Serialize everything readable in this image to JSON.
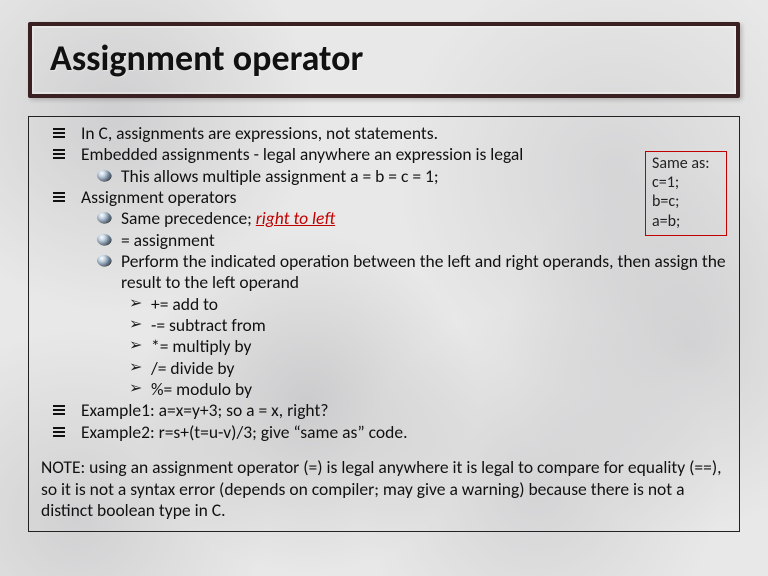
{
  "title": "Assignment operator",
  "bullets": {
    "b1": "In C, assignments are expressions, not statements.",
    "b2": "Embedded assignments - legal anywhere an expression is legal",
    "b2_1": "This allows multiple assignment a = b = c = 1;",
    "b3": "Assignment operators",
    "b3_1a": "Same precedence; ",
    "b3_1b": "right to left",
    "b3_2": "= assignment",
    "b3_3": "Perform the indicated operation between the left and right operands, then assign the result to the left operand",
    "b3_3_1": "+= add to",
    "b3_3_2": "-= subtract from",
    "b3_3_3": "*= multiply by",
    "b3_3_4": "/= divide by",
    "b3_3_5": "%= modulo by",
    "b4": "Example1: a=x=y+3; so a = x, right?",
    "b5": "Example2: r=s+(t=u-v)/3; give “same as” code."
  },
  "note": "NOTE: using an assignment operator (=) is legal anywhere it is legal to compare for equality (==), so it is not a syntax error (depends on compiler; may give a warning) because there is not a distinct boolean type in C.",
  "aside": {
    "l1": "Same as:",
    "l2": "c=1;",
    "l3": "b=c;",
    "l4": "a=b;"
  }
}
